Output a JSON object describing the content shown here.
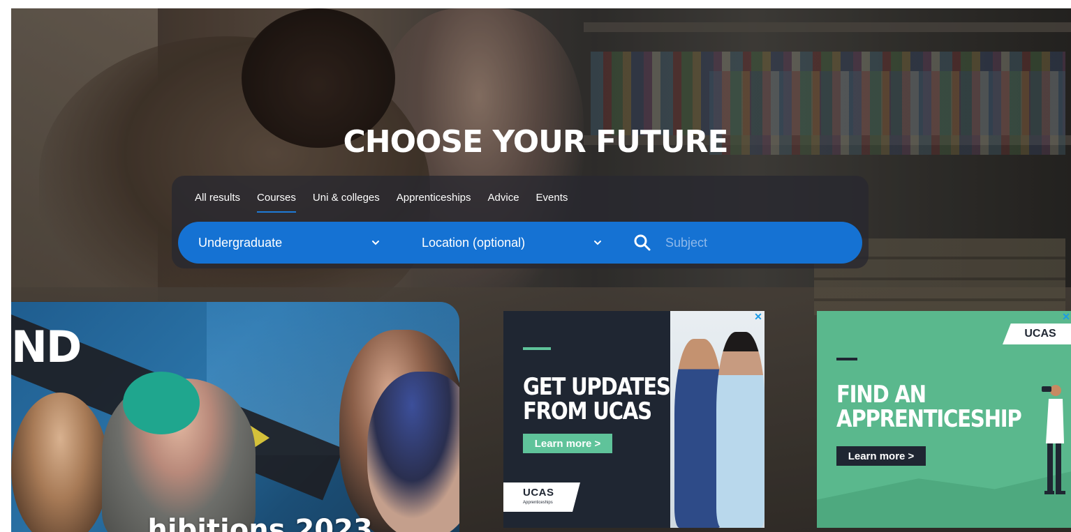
{
  "hero": {
    "title": "CHOOSE YOUR FUTURE"
  },
  "search": {
    "tabs": [
      {
        "label": "All results",
        "active": false
      },
      {
        "label": "Courses",
        "active": true
      },
      {
        "label": "Uni & colleges",
        "active": false
      },
      {
        "label": "Apprenticeships",
        "active": false
      },
      {
        "label": "Advice",
        "active": false
      },
      {
        "label": "Events",
        "active": false
      }
    ],
    "level_select": "Undergraduate",
    "location_select": "Location (optional)",
    "subject_placeholder": "Subject",
    "subject_value": ""
  },
  "cards": {
    "exhibitions": {
      "banner_text": "ND",
      "title_partial": "..hibitions 2023"
    }
  },
  "ads": {
    "updates": {
      "headline": "GET UPDATES FROM UCAS",
      "cta": "Learn more >",
      "logo_brand": "UCAS",
      "logo_sub": "Apprenticeships",
      "close_glyph": "✕"
    },
    "apprenticeship": {
      "logo": "UCAS",
      "headline": "FIND AN APPRENTICESHIP",
      "cta": "Learn more >",
      "close_glyph": "✕"
    }
  },
  "colors": {
    "brand_blue": "#1572d3",
    "accent_green": "#5fc39a",
    "ad_dark": "#1f2632",
    "ad_green": "#5ab88d"
  }
}
